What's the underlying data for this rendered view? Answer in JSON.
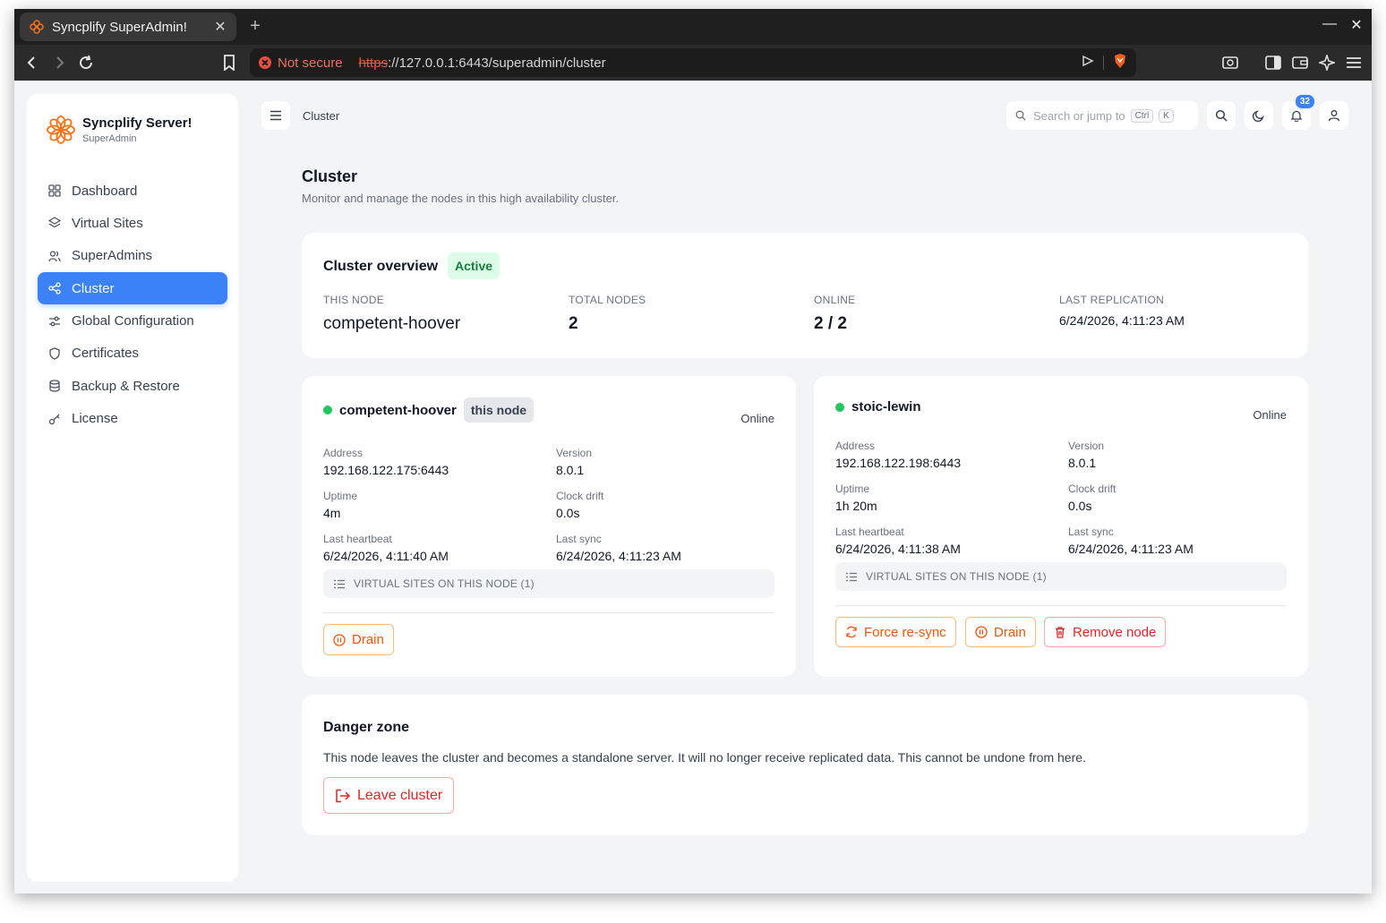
{
  "browser": {
    "tab_title": "Syncplify SuperAdmin!",
    "not_secure": "Not secure",
    "url_scheme": "https",
    "url_rest": "://127.0.0.1:6443/superadmin/cluster"
  },
  "sidebar": {
    "brand_name": "Syncplify Server!",
    "brand_sub": "SuperAdmin",
    "items": [
      {
        "label": "Dashboard",
        "icon": "grid-icon"
      },
      {
        "label": "Virtual Sites",
        "icon": "layers-icon"
      },
      {
        "label": "SuperAdmins",
        "icon": "users-icon"
      },
      {
        "label": "Cluster",
        "icon": "share-icon",
        "active": true
      },
      {
        "label": "Global Configuration",
        "icon": "sliders-icon"
      },
      {
        "label": "Certificates",
        "icon": "shield-icon"
      },
      {
        "label": "Backup & Restore",
        "icon": "database-icon"
      },
      {
        "label": "License",
        "icon": "key-icon"
      }
    ]
  },
  "header": {
    "breadcrumb": "Cluster",
    "search_placeholder": "Search or jump to",
    "kbd_ctrl": "Ctrl",
    "kbd_k": "K",
    "notifications_count": "32"
  },
  "page": {
    "title": "Cluster",
    "subtitle": "Monitor and manage the nodes in this high availability cluster."
  },
  "overview": {
    "title": "Cluster overview",
    "status": "Active",
    "this_node_label": "THIS NODE",
    "this_node_value": "competent-hoover",
    "total_nodes_label": "TOTAL NODES",
    "total_nodes_value": "2",
    "online_label": "ONLINE",
    "online_value": "2 / 2",
    "last_replication_label": "LAST REPLICATION",
    "last_replication_value": "6/24/2026, 4:11:23 AM"
  },
  "nodes": [
    {
      "name": "competent-hoover",
      "tag": "this node",
      "status": "Online",
      "address_label": "Address",
      "address": "192.168.122.175:6443",
      "version_label": "Version",
      "version": "8.0.1",
      "uptime_label": "Uptime",
      "uptime": "4m",
      "drift_label": "Clock drift",
      "drift": "0.0s",
      "heartbeat_label": "Last heartbeat",
      "heartbeat": "6/24/2026, 4:11:40 AM",
      "sync_label": "Last sync",
      "sync": "6/24/2026, 4:11:23 AM",
      "vsites": "VIRTUAL SITES ON THIS NODE (1)",
      "drain_label": "Drain"
    },
    {
      "name": "stoic-lewin",
      "status": "Online",
      "address_label": "Address",
      "address": "192.168.122.198:6443",
      "version_label": "Version",
      "version": "8.0.1",
      "uptime_label": "Uptime",
      "uptime": "1h 20m",
      "drift_label": "Clock drift",
      "drift": "0.0s",
      "heartbeat_label": "Last heartbeat",
      "heartbeat": "6/24/2026, 4:11:38 AM",
      "sync_label": "Last sync",
      "sync": "6/24/2026, 4:11:23 AM",
      "vsites": "VIRTUAL SITES ON THIS NODE (1)",
      "resync_label": "Force re-sync",
      "drain_label": "Drain",
      "remove_label": "Remove node"
    }
  ],
  "danger": {
    "title": "Danger zone",
    "text": "This node leaves the cluster and becomes a standalone server. It will no longer receive replicated data. This cannot be undone from here.",
    "leave_label": "Leave cluster"
  },
  "colors": {
    "accent": "#3b82f6",
    "online": "#22c55e",
    "warning": "#ea580c",
    "danger": "#dc2626",
    "active_bg": "#dcfce7",
    "active_fg": "#15803d"
  }
}
